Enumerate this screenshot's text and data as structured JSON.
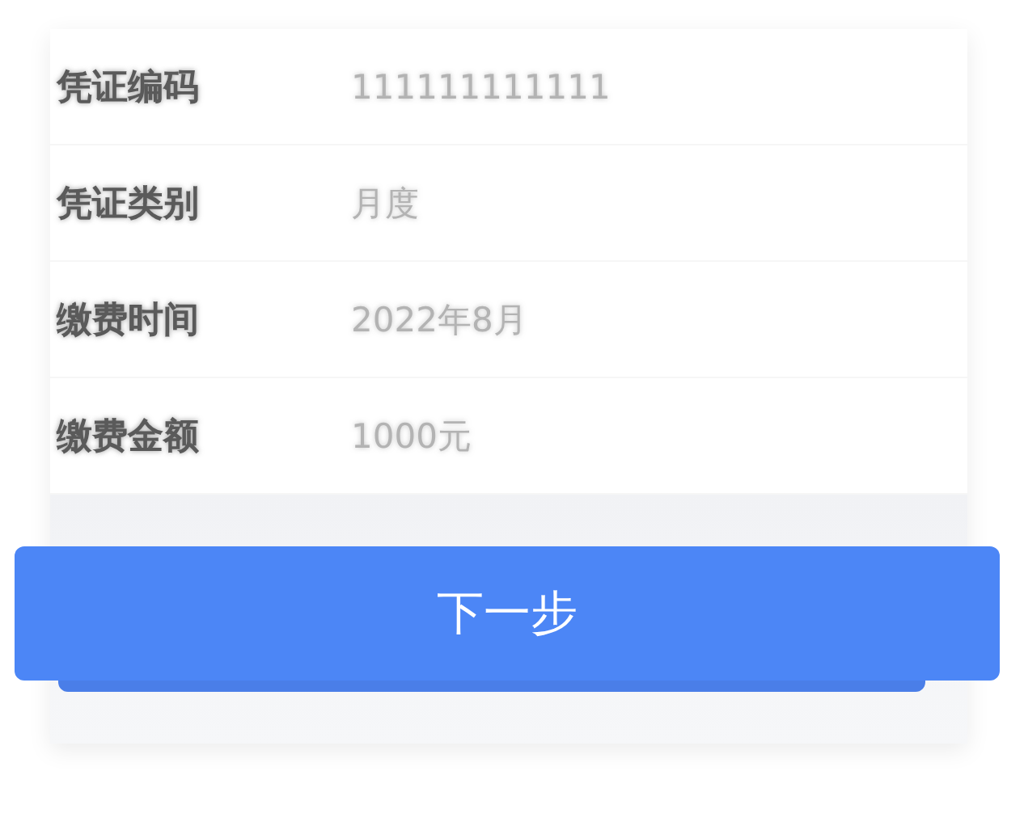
{
  "fields": [
    {
      "label": "凭证编码",
      "value": "111111111111"
    },
    {
      "label": "凭证类别",
      "value": "月度"
    },
    {
      "label": "缴费时间",
      "value": "2022年8月"
    },
    {
      "label": "缴费金额",
      "value": "1000元"
    }
  ],
  "button": {
    "label": "下一步"
  }
}
